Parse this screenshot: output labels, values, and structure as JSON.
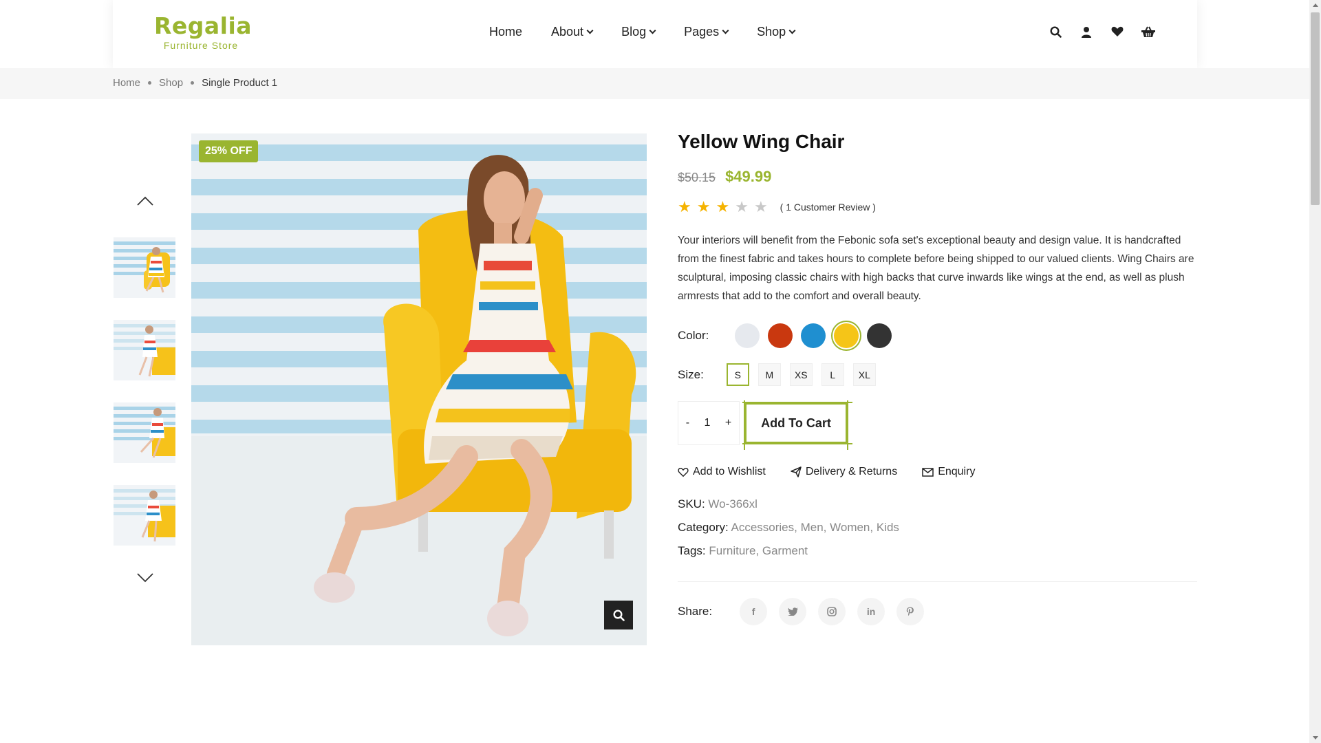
{
  "logo": {
    "title": "Regalia",
    "subtitle": "Furniture Store"
  },
  "nav": {
    "items": [
      {
        "label": "Home",
        "has_dropdown": false
      },
      {
        "label": "About",
        "has_dropdown": true
      },
      {
        "label": "Blog",
        "has_dropdown": true
      },
      {
        "label": "Pages",
        "has_dropdown": true
      },
      {
        "label": "Shop",
        "has_dropdown": true
      }
    ],
    "icons": [
      "search-icon",
      "user-icon",
      "heart-icon",
      "basket-icon"
    ]
  },
  "breadcrumb": {
    "items": [
      "Home",
      "Shop"
    ],
    "current": "Single Product 1"
  },
  "gallery": {
    "badge": "25% OFF",
    "thumbnail_count": 4
  },
  "product": {
    "title": "Yellow Wing Chair",
    "old_price": "$50.15",
    "new_price": "$49.99",
    "rating": 3,
    "rating_max": 5,
    "review_text": "( 1 Customer Review )",
    "description": "Your interiors will benefit from the Febonic sofa set's exceptional beauty and design value. It is handcrafted from the finest fabric and takes hours to complete before being shipped to our valued clients. Wing Chairs are sculptural, imposing classic chairs with high backs that curve inwards like wings at the end, as well as plush armrests that add to the comfort and overall beauty.",
    "color_label": "Color:",
    "colors": [
      "#e6e9ee",
      "#c9380f",
      "#1f8fd0",
      "#f5c518",
      "#333333"
    ],
    "selected_color_index": 3,
    "size_label": "Size:",
    "sizes": [
      "S",
      "M",
      "XS",
      "L",
      "XL"
    ],
    "selected_size_index": 0,
    "qty_minus": "-",
    "quantity": "1",
    "qty_plus": "+",
    "add_to_cart": "Add To Cart",
    "actions": {
      "wishlist": "Add to Wishlist",
      "delivery": "Delivery & Returns",
      "enquiry": "Enquiry"
    },
    "sku_label": "SKU:",
    "sku": "Wo-366xl",
    "category_label": "Category:",
    "categories": [
      "Accessories",
      "Men",
      "Women",
      "Kids"
    ],
    "tags_label": "Tags:",
    "tags": [
      "Furniture",
      "Garment"
    ],
    "share_label": "Share:",
    "share_icons": [
      "facebook-icon",
      "twitter-icon",
      "instagram-icon",
      "linkedin-icon",
      "pinterest-icon"
    ]
  },
  "colors": {
    "accent": "#9ab530",
    "star_on": "#f5b301",
    "star_off": "#c8c8c8"
  }
}
